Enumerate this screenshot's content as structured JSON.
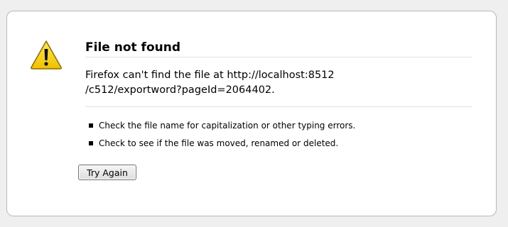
{
  "error": {
    "title": "File not found",
    "message_line1": "Firefox can't find the file at http://localhost:8512",
    "message_line2": "/c512/exportword?pageId=2064402.",
    "icon": "warning-icon",
    "suggestions": [
      {
        "text": "Check the file name for capitalization or other typing errors."
      },
      {
        "text": "Check to see if the file was moved, renamed or deleted."
      }
    ],
    "try_again_label": "Try Again"
  },
  "colors": {
    "page_background": "#efefef",
    "panel_border": "#b8b8b8",
    "warning_yellow": "#f5d010"
  }
}
